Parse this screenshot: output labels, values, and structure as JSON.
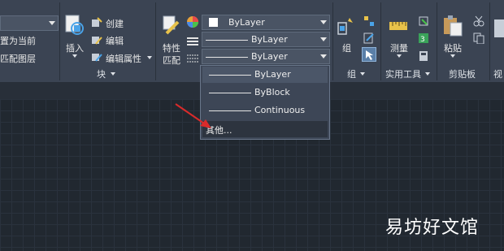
{
  "ribbon": {
    "left": {
      "item_set_current": "置为当前",
      "item_match_layer": "匹配图层"
    },
    "block": {
      "insert_label": "插入",
      "create_label": "创建",
      "edit_label": "编辑",
      "edit_attr_label": "编辑属性",
      "panel_label": "块"
    },
    "properties": {
      "match_label": "特性\n匹配",
      "match_line1": "特性",
      "match_line2": "匹配",
      "color_value": "ByLayer",
      "linetype_value": "ByLayer",
      "lineweight_value": "ByLayer"
    },
    "groups": {
      "group_label": "组",
      "panel_label": "组"
    },
    "utilities": {
      "measure_label": "测量",
      "panel_label": "实用工具"
    },
    "clipboard": {
      "paste_label": "粘贴",
      "panel_label": "剪贴板"
    },
    "view": {
      "panel_label": "视"
    }
  },
  "linetype_dropdown": {
    "options": [
      "ByLayer",
      "ByBlock",
      "Continuous"
    ],
    "other_label": "其他..."
  },
  "watermark": "易坊好文馆",
  "colors": {
    "ribbon_bg": "#3b4453",
    "canvas_bg": "#212830",
    "accent_red": "#d92b2b"
  }
}
